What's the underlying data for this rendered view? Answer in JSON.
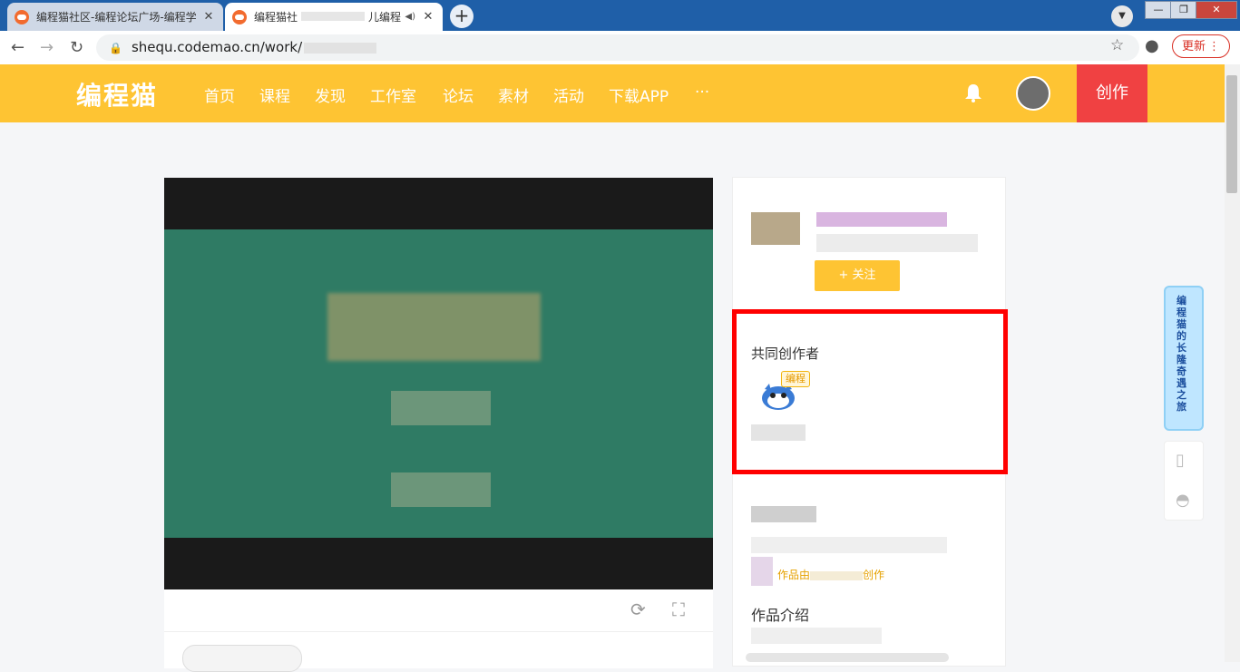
{
  "browser": {
    "tabs": [
      {
        "title": "编程猫社区-编程论坛广场-编程学",
        "active": false
      },
      {
        "title": "编程猫社",
        "title_suffix": "儿编程",
        "active": true
      }
    ],
    "new_tab": "+",
    "close": "✕",
    "url": "shequ.codemao.cn/work/",
    "update_label": "更新",
    "win_controls": {
      "minimize": "—",
      "maximize": "❐",
      "close": "✕"
    }
  },
  "site": {
    "logo": "编程猫",
    "nav": [
      "首页",
      "课程",
      "发现",
      "工作室",
      "论坛",
      "素材",
      "活动",
      "下载APP",
      "···"
    ],
    "create_label": "创作",
    "brand_color": "#fec433"
  },
  "player": {
    "refresh_icon": "⟳",
    "fullscreen_icon": "⛶"
  },
  "sidebar": {
    "follow_label": "+ 关注",
    "co_creators_title": "共同创作者",
    "co_creator_badge": "编程",
    "author_note_prefix": "作品由",
    "author_note_suffix": "创作",
    "intro_title": "作品介绍"
  },
  "floating": {
    "banner_text": "编程猫的长隆奇遇之旅"
  }
}
